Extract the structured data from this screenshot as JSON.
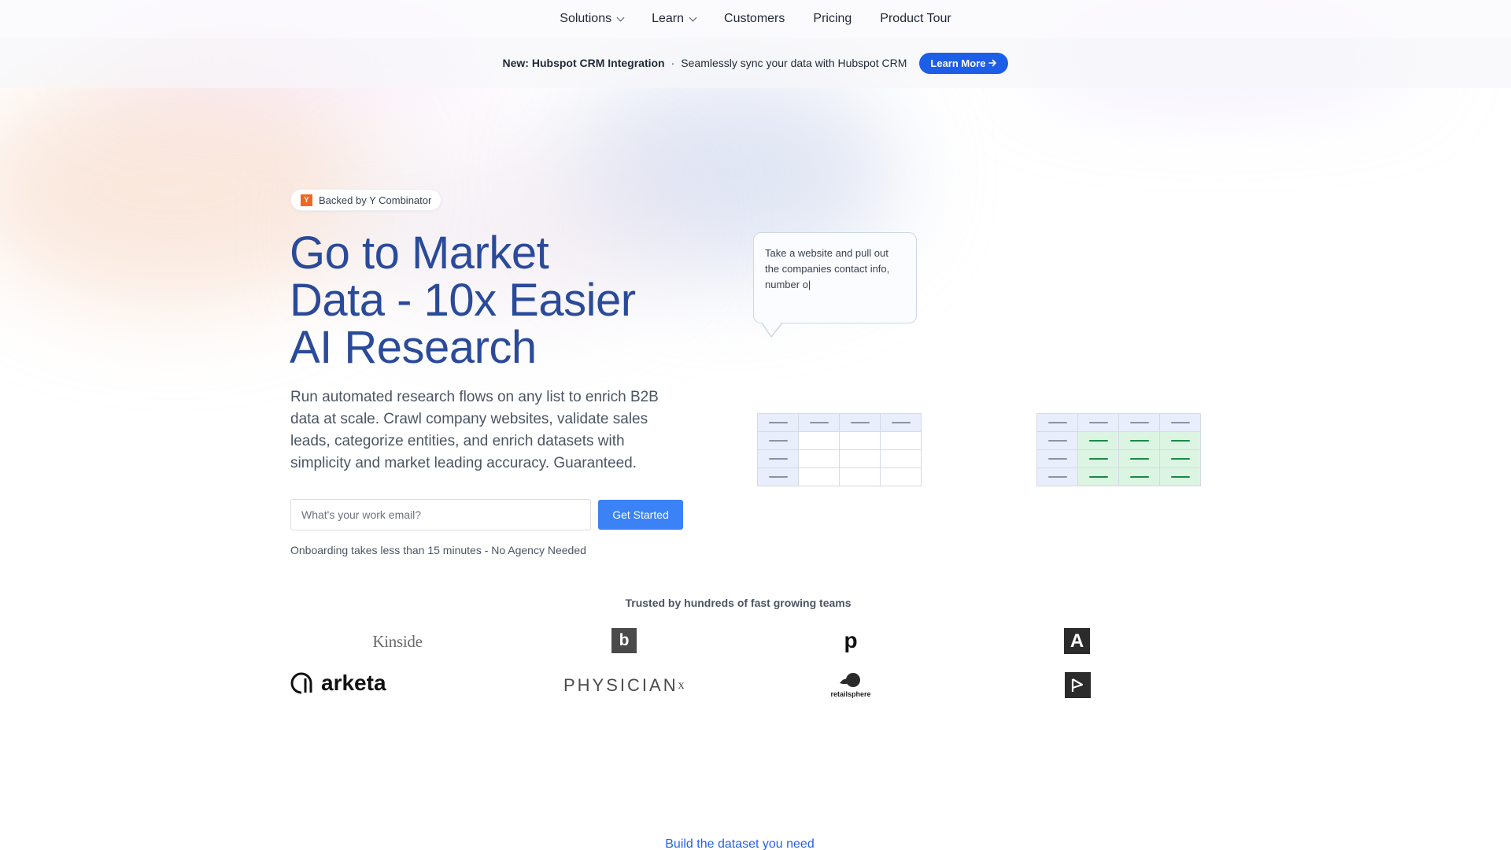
{
  "nav": {
    "items": [
      {
        "label": "Solutions",
        "has_dropdown": true
      },
      {
        "label": "Learn",
        "has_dropdown": true
      },
      {
        "label": "Customers",
        "has_dropdown": false
      },
      {
        "label": "Pricing",
        "has_dropdown": false
      },
      {
        "label": "Product Tour",
        "has_dropdown": false
      }
    ]
  },
  "banner": {
    "title": "New: Hubspot CRM Integration",
    "separator": "·",
    "text": "Seamlessly sync your data with Hubspot CRM",
    "button_label": "Learn More",
    "button_icon": "arrow-right-icon",
    "button_color": "#1d5ee8"
  },
  "hero": {
    "badge_logo": "Y",
    "badge_text": "Backed by Y Combinator",
    "badge_color": "#f26522",
    "headline_lines": [
      "Go to Market",
      "Data - 10x Easier",
      "AI Research"
    ],
    "headline_color": "#2a4a9a",
    "subtext": "Run automated research flows on any list to enrich B2B data at scale. Crawl company websites, validate sales leads, categorize entities, and enrich datasets with simplicity and market leading accuracy. Guaranteed.",
    "email_placeholder": "What's your work email?",
    "email_value": "",
    "cta_label": "Get Started",
    "cta_color": "#3b82f6",
    "onboarding_note": "Onboarding takes less than 15 minutes - No Agency Needed"
  },
  "illustration": {
    "prompt_text": "Take a website and pull out the companies contact info, number o|",
    "grid_rows": 4,
    "grid_cols": 4,
    "accent_green": "#198a45"
  },
  "trusted": {
    "title": "Trusted by hundreds of fast growing teams",
    "logos": [
      {
        "name": "Kinside",
        "text": "Kinside"
      },
      {
        "name": "b-logo",
        "text": "b"
      },
      {
        "name": "p-logo",
        "text": "p"
      },
      {
        "name": "a-logo",
        "text": "A"
      },
      {
        "name": "arketa",
        "text": "arketa"
      },
      {
        "name": "physician-x",
        "text": "PHYSICIAN",
        "sup": "x"
      },
      {
        "name": "retailsphere",
        "text": "retailsphere"
      },
      {
        "name": "t-logo",
        "text": ""
      }
    ]
  },
  "next_section": {
    "heading": "Build the dataset you need"
  }
}
